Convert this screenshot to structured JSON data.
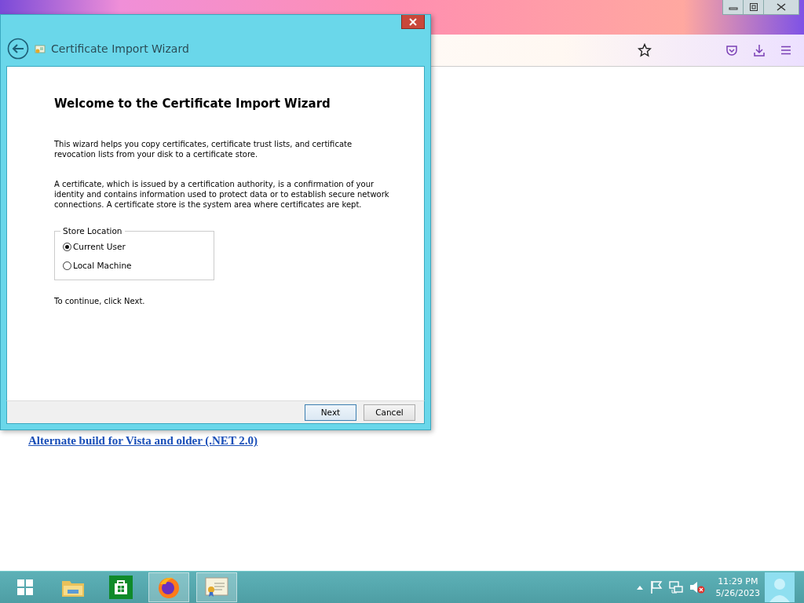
{
  "browser": {
    "link": "Alternate build for Vista and older (.NET 2.0)"
  },
  "dialog": {
    "title": "Certificate Import Wizard",
    "heading": "Welcome to the Certificate Import Wizard",
    "paragraphs": [
      "This wizard helps you copy certificates, certificate trust lists, and certificate revocation lists from your disk to a certificate store.",
      "A certificate, which is issued by a certification authority, is a confirmation of your identity and contains information used to protect data or to establish secure network connections. A certificate store is the system area where certificates are kept."
    ],
    "store_location": {
      "label": "Store Location",
      "options": [
        {
          "label": "Current User",
          "selected": true
        },
        {
          "label": "Local Machine",
          "selected": false
        }
      ]
    },
    "instruction": "To continue, click Next.",
    "buttons": [
      {
        "label": "Next",
        "default": true
      },
      {
        "label": "Cancel",
        "default": false
      }
    ]
  },
  "taskbar": {
    "apps": [
      {
        "kind": "explorer",
        "active": false
      },
      {
        "kind": "store",
        "active": false
      },
      {
        "kind": "firefox",
        "active": true
      },
      {
        "kind": "certificate",
        "active": true
      }
    ],
    "clock": {
      "time": "11:29 PM",
      "date": "5/26/2023"
    }
  }
}
